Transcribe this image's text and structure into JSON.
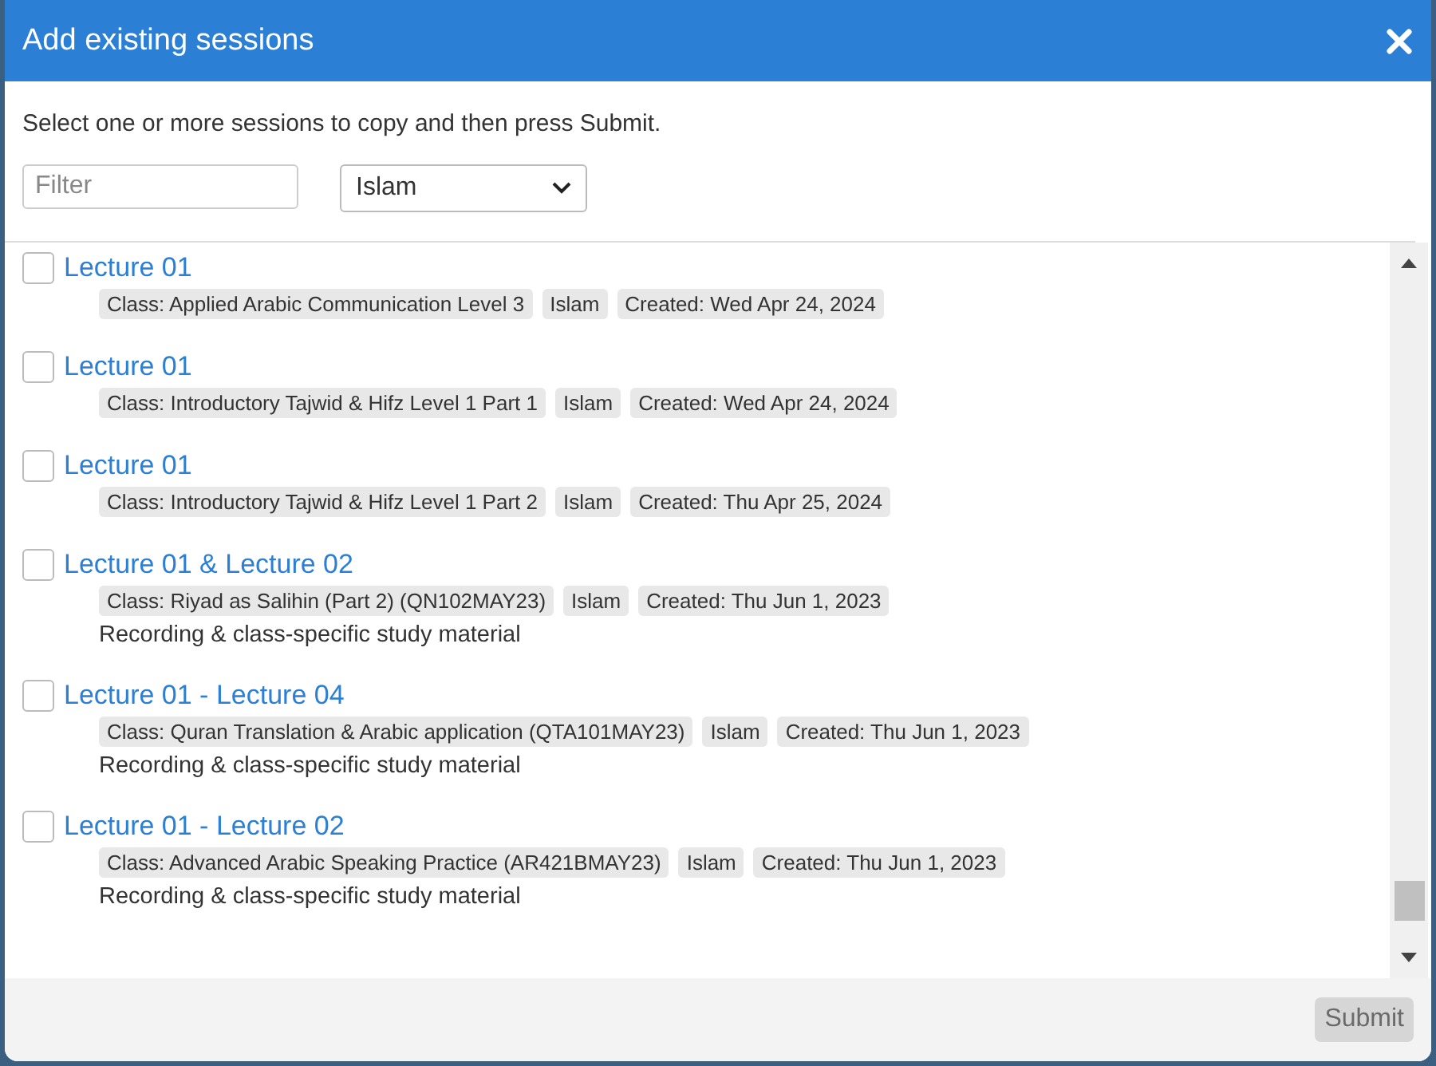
{
  "dialog": {
    "title": "Add existing sessions",
    "instructions": "Select one or more sessions to copy and then press Submit."
  },
  "filter": {
    "placeholder": "Filter"
  },
  "category_select": {
    "value": "Islam"
  },
  "sessions": [
    {
      "title": "Lecture 01",
      "checked": false,
      "tags": [
        "Class: Applied Arabic Communication Level 3",
        "Islam",
        "Created: Wed Apr 24, 2024"
      ]
    },
    {
      "title": "Lecture 01",
      "checked": false,
      "tags": [
        "Class: Introductory Tajwid & Hifz Level 1 Part 1",
        "Islam",
        "Created: Wed Apr 24, 2024"
      ]
    },
    {
      "title": "Lecture 01",
      "checked": false,
      "tags": [
        "Class: Introductory Tajwid & Hifz Level 1 Part 2",
        "Islam",
        "Created: Thu Apr 25, 2024"
      ]
    },
    {
      "title": "Lecture 01 & Lecture 02",
      "checked": false,
      "tags": [
        "Class: Riyad as Salihin (Part 2) (QN102MAY23)",
        "Islam",
        "Created: Thu Jun 1, 2023"
      ],
      "description": "Recording & class-specific study material"
    },
    {
      "title": "Lecture 01 - Lecture 04",
      "checked": false,
      "tags": [
        "Class: Quran Translation & Arabic application (QTA101MAY23)",
        "Islam",
        "Created: Thu Jun 1, 2023"
      ],
      "description": "Recording & class-specific study material"
    },
    {
      "title": "Lecture 01 - Lecture 02",
      "checked": false,
      "tags": [
        "Class: Advanced Arabic Speaking Practice (AR421BMAY23)",
        "Islam",
        "Created: Thu Jun 1, 2023"
      ],
      "description": "Recording & class-specific study material"
    }
  ],
  "submit_button": {
    "label": "Submit",
    "disabled": true
  }
}
